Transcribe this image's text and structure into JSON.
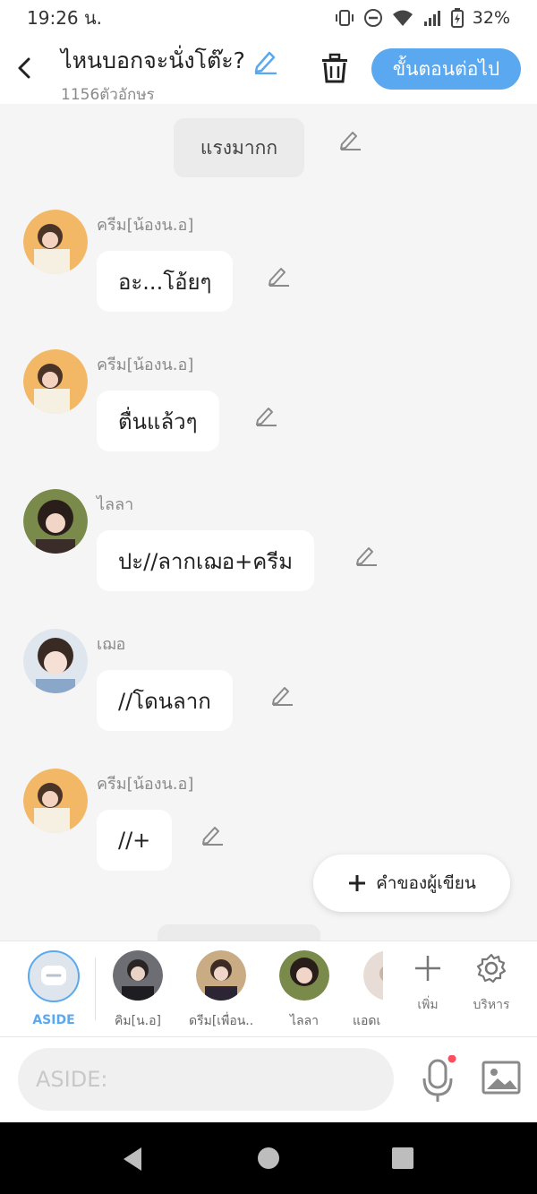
{
  "status_bar": {
    "time": "19:26 น.",
    "battery": "32%"
  },
  "header": {
    "title": "ไหนบอกจะนั่งโต๊ะ?",
    "subtitle": "1156ตัวอักษร",
    "next_label": "ขั้นตอนต่อไป"
  },
  "messages": [
    {
      "type": "narration",
      "text": "แรงมากก"
    },
    {
      "type": "chat",
      "name": "ครีม[น้องน.อ]",
      "text": "อะ...โอ้ยๆ"
    },
    {
      "type": "chat",
      "name": "ครีม[น้องน.อ]",
      "text": "ตื่นแล้วๆ"
    },
    {
      "type": "chat",
      "name": "ไลลา",
      "text": "ปะ//ลากเฌอ+ครีม"
    },
    {
      "type": "chat",
      "name": "เฌอ",
      "text": "//โดนลาก"
    },
    {
      "type": "chat",
      "name": "ครีม[น้องน.อ]",
      "text": "//+"
    }
  ],
  "fab": {
    "label": "คำของผู้เขียน"
  },
  "characters": [
    {
      "label": "ASIDE"
    },
    {
      "label": "คิม[น.อ]"
    },
    {
      "label": "ดรีม[เพื่อน..."
    },
    {
      "label": "ไลลา"
    },
    {
      "label": "แอดเ"
    }
  ],
  "tools": {
    "add_label": "เพิ่ม",
    "manage_label": "บริหาร"
  },
  "input": {
    "placeholder": "ASIDE:"
  },
  "colors": {
    "accent": "#5aa9f0",
    "background": "#f5f5f5",
    "bubble": "#ffffff"
  }
}
